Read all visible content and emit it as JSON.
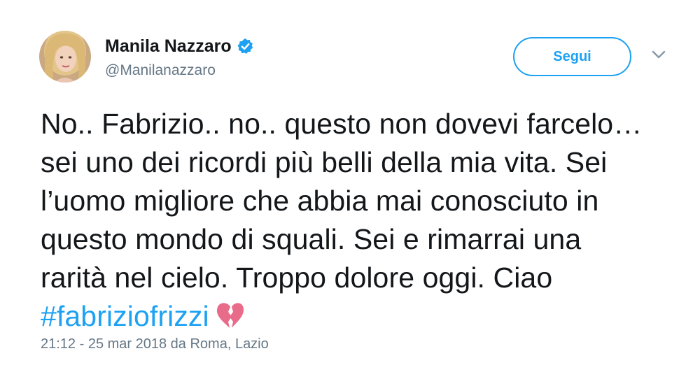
{
  "author": {
    "name": "Manila Nazzaro",
    "handle": "@Manilanazzaro"
  },
  "follow_button": {
    "label": "Segui"
  },
  "tweet": {
    "lines": [
      "No.. Fabrizio.. no.. questo non dovevi farcelo…",
      "sei uno dei ricordi più belli della mia vita. Sei",
      "l’uomo migliore che abbia mai conosciuto in",
      "questo mondo di squali. Sei e rimarrai una",
      "rarità nel cielo. Troppo dolore oggi. Ciao"
    ],
    "hashtag": "#fabriziofrizzi",
    "emoji": "broken-heart-icon"
  },
  "meta": {
    "timestamp": "21:12 - 25 mar 2018 da Roma, Lazio"
  },
  "colors": {
    "accent": "#1da1f2",
    "text": "#14171a",
    "muted": "#657786",
    "heart": "#e86b8a"
  }
}
